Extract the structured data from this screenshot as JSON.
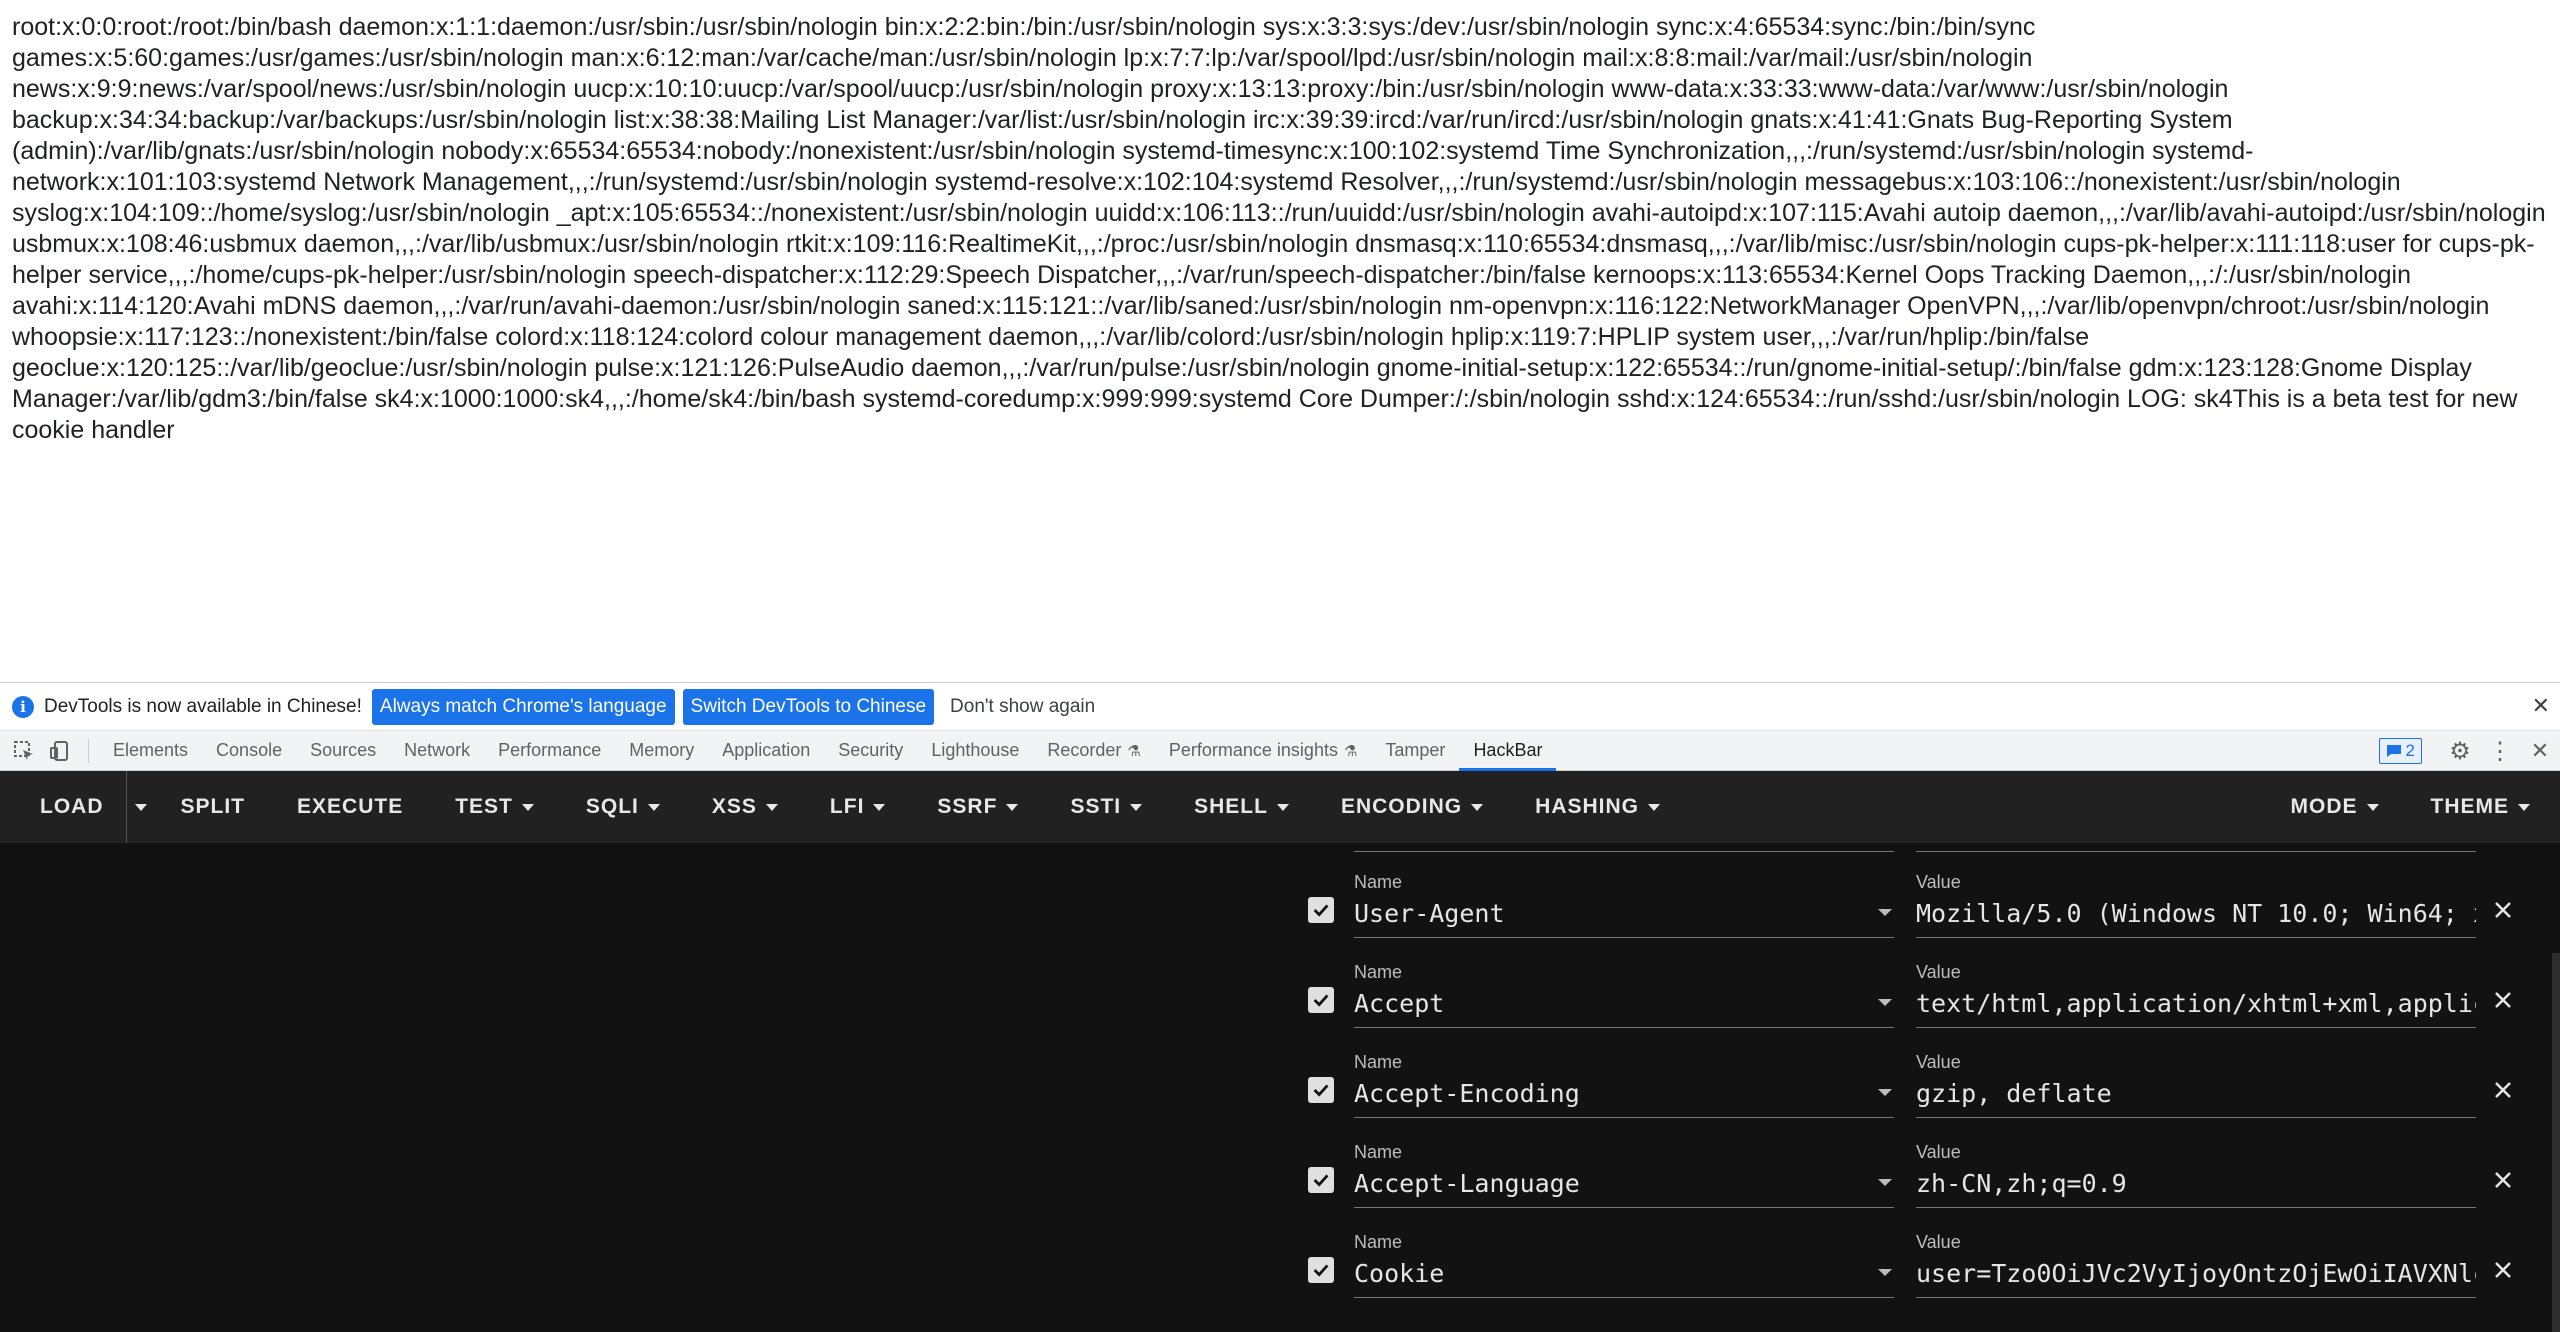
{
  "page": {
    "content": "root:x:0:0:root:/root:/bin/bash daemon:x:1:1:daemon:/usr/sbin:/usr/sbin/nologin bin:x:2:2:bin:/bin:/usr/sbin/nologin sys:x:3:3:sys:/dev:/usr/sbin/nologin sync:x:4:65534:sync:/bin:/bin/sync games:x:5:60:games:/usr/games:/usr/sbin/nologin man:x:6:12:man:/var/cache/man:/usr/sbin/nologin lp:x:7:7:lp:/var/spool/lpd:/usr/sbin/nologin mail:x:8:8:mail:/var/mail:/usr/sbin/nologin news:x:9:9:news:/var/spool/news:/usr/sbin/nologin uucp:x:10:10:uucp:/var/spool/uucp:/usr/sbin/nologin proxy:x:13:13:proxy:/bin:/usr/sbin/nologin www-data:x:33:33:www-data:/var/www:/usr/sbin/nologin backup:x:34:34:backup:/var/backups:/usr/sbin/nologin list:x:38:38:Mailing List Manager:/var/list:/usr/sbin/nologin irc:x:39:39:ircd:/var/run/ircd:/usr/sbin/nologin gnats:x:41:41:Gnats Bug-Reporting System (admin):/var/lib/gnats:/usr/sbin/nologin nobody:x:65534:65534:nobody:/nonexistent:/usr/sbin/nologin systemd-timesync:x:100:102:systemd Time Synchronization,,,:/run/systemd:/usr/sbin/nologin systemd-network:x:101:103:systemd Network Management,,,:/run/systemd:/usr/sbin/nologin systemd-resolve:x:102:104:systemd Resolver,,,:/run/systemd:/usr/sbin/nologin messagebus:x:103:106::/nonexistent:/usr/sbin/nologin syslog:x:104:109::/home/syslog:/usr/sbin/nologin _apt:x:105:65534::/nonexistent:/usr/sbin/nologin uuidd:x:106:113::/run/uuidd:/usr/sbin/nologin avahi-autoipd:x:107:115:Avahi autoip daemon,,,:/var/lib/avahi-autoipd:/usr/sbin/nologin usbmux:x:108:46:usbmux daemon,,,:/var/lib/usbmux:/usr/sbin/nologin rtkit:x:109:116:RealtimeKit,,,:/proc:/usr/sbin/nologin dnsmasq:x:110:65534:dnsmasq,,,:/var/lib/misc:/usr/sbin/nologin cups-pk-helper:x:111:118:user for cups-pk-helper service,,,:/home/cups-pk-helper:/usr/sbin/nologin speech-dispatcher:x:112:29:Speech Dispatcher,,,:/var/run/speech-dispatcher:/bin/false kernoops:x:113:65534:Kernel Oops Tracking Daemon,,,:/:/usr/sbin/nologin avahi:x:114:120:Avahi mDNS daemon,,,:/var/run/avahi-daemon:/usr/sbin/nologin saned:x:115:121::/var/lib/saned:/usr/sbin/nologin nm-openvpn:x:116:122:NetworkManager OpenVPN,,,:/var/lib/openvpn/chroot:/usr/sbin/nologin whoopsie:x:117:123::/nonexistent:/bin/false colord:x:118:124:colord colour management daemon,,,:/var/lib/colord:/usr/sbin/nologin hplip:x:119:7:HPLIP system user,,,:/var/run/hplip:/bin/false geoclue:x:120:125::/var/lib/geoclue:/usr/sbin/nologin pulse:x:121:126:PulseAudio daemon,,,:/var/run/pulse:/usr/sbin/nologin gnome-initial-setup:x:122:65534::/run/gnome-initial-setup/:/bin/false gdm:x:123:128:Gnome Display Manager:/var/lib/gdm3:/bin/false sk4:x:1000:1000:sk4,,,:/home/sk4:/bin/bash systemd-coredump:x:999:999:systemd Core Dumper:/:/sbin/nologin sshd:x:124:65534::/run/sshd:/usr/sbin/nologin LOG: sk4This is a beta test for new cookie handler"
  },
  "infobar": {
    "message": "DevTools is now available in Chinese!",
    "btn_match": "Always match Chrome's language",
    "btn_switch": "Switch DevTools to Chinese",
    "btn_dont_show": "Don't show again",
    "icon": "info-icon"
  },
  "devtools": {
    "tabs": [
      "Elements",
      "Console",
      "Sources",
      "Network",
      "Performance",
      "Memory",
      "Application",
      "Security",
      "Lighthouse",
      "Recorder",
      "Performance insights",
      "Tamper",
      "HackBar"
    ],
    "active_tab": "HackBar",
    "messages_count": "2"
  },
  "hackbar": {
    "toolbar": {
      "load": "LOAD",
      "split": "SPLIT",
      "execute": "EXECUTE",
      "test": "TEST",
      "sqli": "SQLI",
      "xss": "XSS",
      "lfi": "LFI",
      "ssrf": "SSRF",
      "ssti": "SSTI",
      "shell": "SHELL",
      "encoding": "ENCODING",
      "hashing": "HASHING",
      "mode": "MODE",
      "theme": "THEME"
    },
    "name_label": "Name",
    "value_label": "Value",
    "headers": [
      {
        "name": "User-Agent",
        "value": "Mozilla/5.0 (Windows NT 10.0; Win64; x",
        "checked": true
      },
      {
        "name": "Accept",
        "value": "text/html,application/xhtml+xml,applic",
        "checked": true
      },
      {
        "name": "Accept-Encoding",
        "value": "gzip, deflate",
        "checked": true
      },
      {
        "name": "Accept-Language",
        "value": "zh-CN,zh;q=0.9",
        "checked": true
      },
      {
        "name": "Cookie",
        "value": "user=Tzo0OiJVc2VyIjoyOntzOjEwOiIAVXNlc",
        "checked": true
      }
    ]
  },
  "colors": {
    "accent": "#1a73e8",
    "hackbar_toolbar": "#212121",
    "hackbar_body": "#121212"
  }
}
